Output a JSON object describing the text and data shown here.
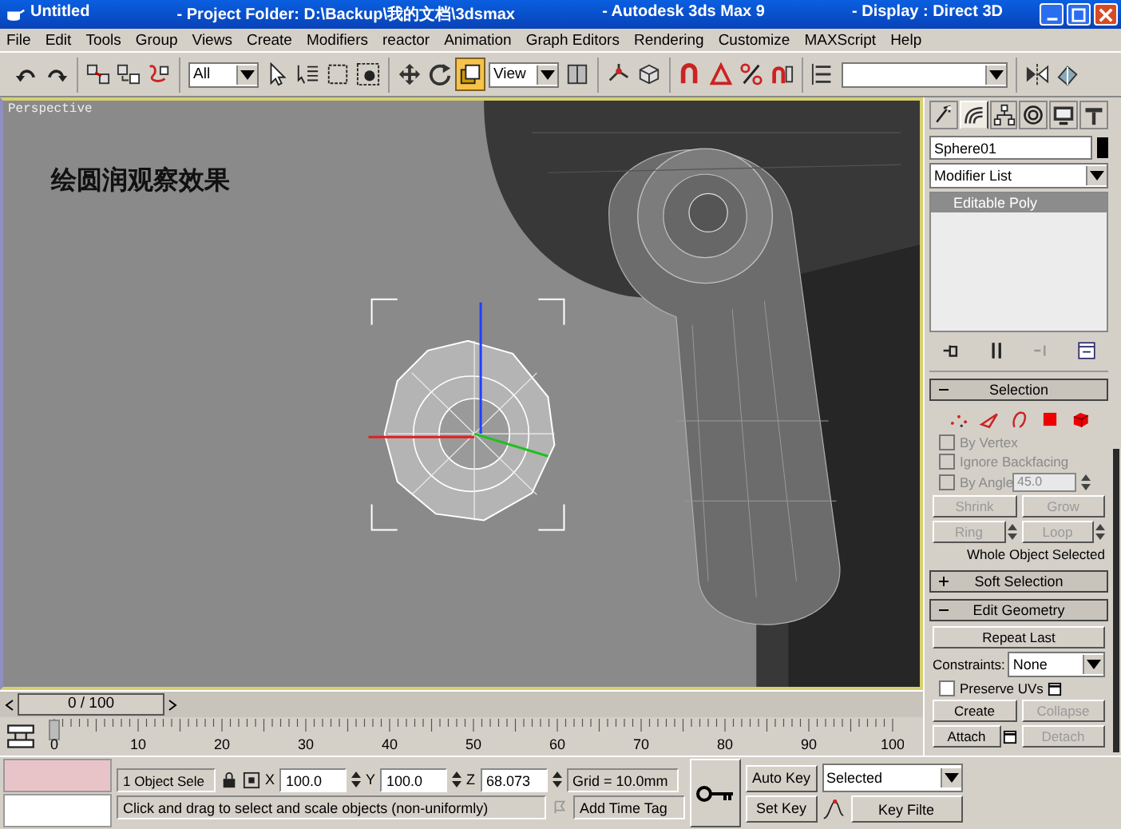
{
  "window": {
    "title_parts": [
      "Untitled",
      "- Project Folder: D:\\Backup\\我的文档\\3dsmax",
      "- Autodesk 3ds Max 9",
      "- Display : Direct 3D"
    ]
  },
  "menu": [
    "File",
    "Edit",
    "Tools",
    "Group",
    "Views",
    "Create",
    "Modifiers",
    "reactor",
    "Animation",
    "Graph Editors",
    "Rendering",
    "Customize",
    "MAXScript",
    "Help"
  ],
  "toolbar": {
    "groups": [
      [
        {
          "kind": "icon",
          "selected": false
        },
        {
          "kind": "icon",
          "selected": false
        }
      ],
      [
        {
          "kind": "icon",
          "selected": false
        },
        {
          "kind": "icon",
          "selected": false
        },
        {
          "kind": "icon",
          "selected": false
        }
      ],
      [
        {
          "kind": "dropdown",
          "value": "All"
        },
        {
          "kind": "icon",
          "selected": false
        },
        {
          "kind": "icon",
          "selected": false
        },
        {
          "kind": "icon",
          "selected": false
        },
        {
          "kind": "icon",
          "selected": false
        }
      ],
      [
        {
          "kind": "icon",
          "selected": false
        },
        {
          "kind": "icon",
          "selected": false
        },
        {
          "kind": "icon",
          "selected": true
        },
        {
          "kind": "dropdown",
          "value": "View"
        },
        {
          "kind": "icon",
          "selected": false
        }
      ],
      [
        {
          "kind": "icon",
          "selected": false
        },
        {
          "kind": "icon",
          "selected": false
        }
      ],
      [
        {
          "kind": "icon",
          "selected": false
        },
        {
          "kind": "icon",
          "selected": false
        },
        {
          "kind": "icon",
          "selected": false
        },
        {
          "kind": "icon",
          "selected": false
        }
      ],
      [
        {
          "kind": "icon",
          "selected": false
        },
        {
          "kind": "dropdown"
        }
      ],
      [
        {
          "kind": "icon",
          "selected": false
        },
        {
          "kind": "icon",
          "selected": false
        }
      ]
    ]
  },
  "viewport": {
    "label": "Perspective",
    "caption": "绘圆润观察效果"
  },
  "command_panel": {
    "tabs": [
      {
        "selected": false
      },
      {
        "selected": true
      },
      {
        "selected": false
      },
      {
        "selected": false
      },
      {
        "selected": false
      },
      {
        "selected": false
      }
    ],
    "object_name": "Sphere01",
    "modifier_list": "Modifier List",
    "stack": [
      {
        "label": "Editable Poly",
        "selected": true
      }
    ],
    "rollouts": [
      {
        "kind": "selection",
        "title": "Selection",
        "expanded": true,
        "subobjects": [
          {
            "selected": false
          },
          {
            "selected": false
          },
          {
            "selected": false
          },
          {
            "selected": false
          },
          {
            "selected": false
          }
        ],
        "checkboxes": [
          {
            "label": "By Vertex",
            "checked": false,
            "disabled": true
          },
          {
            "label": "Ignore Backfacing",
            "checked": false,
            "disabled": true
          }
        ],
        "angle": {
          "label": "By Angle",
          "checked": false,
          "disabled": true,
          "value": "45.0"
        },
        "buttons": [
          {
            "label": "Shrink",
            "disabled": true
          },
          {
            "label": "Grow",
            "disabled": true
          }
        ],
        "spin_buttons": [
          {
            "label": "Ring",
            "disabled": true
          },
          {
            "label": "Loop",
            "disabled": true
          }
        ],
        "status": "Whole Object Selected"
      },
      {
        "title": "Soft Selection",
        "expanded": false
      },
      {
        "kind": "edit_geometry",
        "title": "Edit Geometry",
        "expanded": true,
        "repeat": "Repeat Last",
        "constraints_label": "Constraints:",
        "constraints_value": "None",
        "preserve": {
          "label": "Preserve UVs",
          "checked": false
        },
        "button_rows": [
          [
            {
              "label": "Create",
              "disabled": false
            },
            {
              "label": "Collapse",
              "disabled": true
            }
          ],
          [
            {
              "label": "Attach",
              "disabled": false,
              "settings": true
            },
            {
              "label": "Detach",
              "disabled": true
            }
          ]
        ]
      }
    ]
  },
  "time_slider": {
    "label": "0 / 100",
    "level": 0
  },
  "trackbar": {
    "labels": [
      "0",
      "10",
      "20",
      "30",
      "40",
      "50",
      "60",
      "70",
      "80",
      "90",
      "100"
    ]
  },
  "status_bar": {
    "selection": "1 Object Sele",
    "coordinates": [
      {
        "axis": "X",
        "value": "100.0"
      },
      {
        "axis": "Y",
        "value": "100.0"
      },
      {
        "axis": "Z",
        "value": "68.073"
      }
    ],
    "grid": "Grid = 10.0mm",
    "prompt": "Click and drag to select and scale objects (non-uniformly)",
    "time_tag": "Add Time Tag",
    "auto_key": "Auto Key",
    "set_key": "Set Key",
    "key_mode": "Selected",
    "key_filters": "Key Filte"
  }
}
